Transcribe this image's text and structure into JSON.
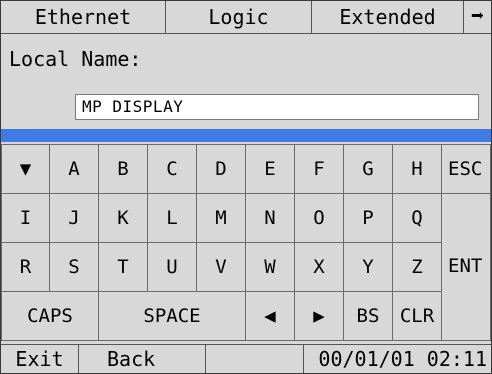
{
  "tabs": [
    {
      "label": "Ethernet"
    },
    {
      "label": "Logic"
    },
    {
      "label": "Extended"
    },
    {
      "label": "➡"
    }
  ],
  "local_name": {
    "label": "Local Name:",
    "value": "MP DISPLAY"
  },
  "keyboard": {
    "row1": [
      "▼",
      "A",
      "B",
      "C",
      "D",
      "E",
      "F",
      "G",
      "H",
      "ESC"
    ],
    "row2": [
      "I",
      "J",
      "K",
      "L",
      "M",
      "N",
      "O",
      "P",
      "Q"
    ],
    "row3": [
      "R",
      "S",
      "T",
      "U",
      "V",
      "W",
      "X",
      "Y",
      "Z",
      "ENT"
    ],
    "row4": [
      "CAPS",
      "SPACE",
      "◀",
      "▶",
      "BS",
      "CLR"
    ]
  },
  "status_bar": {
    "exit": "Exit",
    "back": "Back",
    "clock": "00/01/01 02:11"
  },
  "colors": {
    "panel": "#d8d8d8",
    "accent_bar": "#3f7be3",
    "input_bg": "#ffffff"
  }
}
